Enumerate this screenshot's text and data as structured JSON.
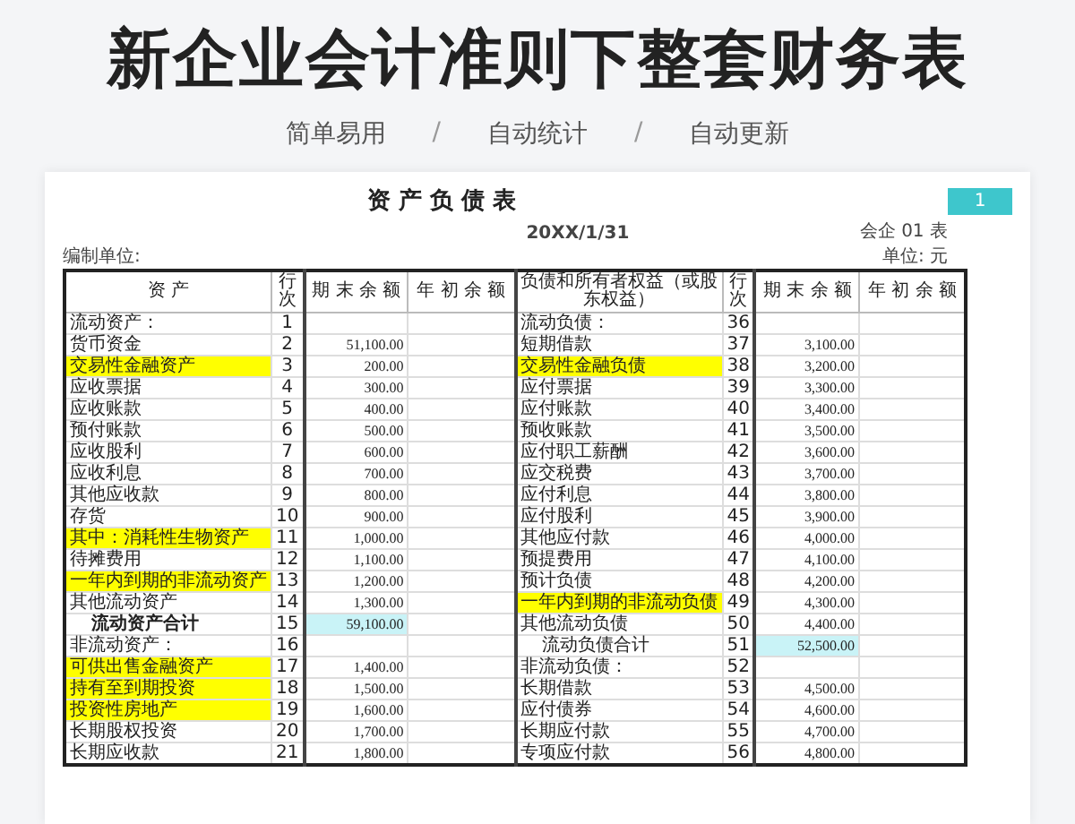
{
  "headline": "新企业会计准则下整套财务表",
  "taglines": [
    "简单易用",
    "自动统计",
    "自动更新"
  ],
  "tagline_separator": "/",
  "sheet": {
    "title": "资 产 负 债 表",
    "page_badge": "1",
    "form_code": "会企 01 表",
    "date": "20XX/1/31",
    "company_label": "编制单位:",
    "unit_label": "单位: 元",
    "columns": [
      "资 产",
      "行次",
      "期 末 余 额",
      "年 初 余 额",
      "负债和所有者权益（或股东权益）",
      "行次",
      "期 末 余 额",
      "年 初 余 额"
    ],
    "rows": [
      {
        "left": {
          "name": "流动资产：",
          "no": "1",
          "highlighted": false,
          "subtotal": false,
          "bold": false
        },
        "right": {
          "name": "流动负债：",
          "no": "36",
          "highlighted": false,
          "subtotal": false,
          "bold": false
        }
      },
      {
        "left": {
          "name": "货币资金",
          "no": "2",
          "end": "51,100.00",
          "highlighted": false,
          "subtotal": false,
          "bold": false
        },
        "right": {
          "name": "短期借款",
          "no": "37",
          "end": "3,100.00",
          "highlighted": false,
          "subtotal": false,
          "bold": false
        }
      },
      {
        "left": {
          "name": "交易性金融资产",
          "no": "3",
          "end": "200.00",
          "highlighted": true,
          "subtotal": false,
          "bold": false
        },
        "right": {
          "name": "交易性金融负债",
          "no": "38",
          "end": "3,200.00",
          "highlighted": true,
          "subtotal": false,
          "bold": false
        }
      },
      {
        "left": {
          "name": "应收票据",
          "no": "4",
          "end": "300.00",
          "highlighted": false,
          "subtotal": false,
          "bold": false
        },
        "right": {
          "name": "应付票据",
          "no": "39",
          "end": "3,300.00",
          "highlighted": false,
          "subtotal": false,
          "bold": false
        }
      },
      {
        "left": {
          "name": "应收账款",
          "no": "5",
          "end": "400.00",
          "highlighted": false,
          "subtotal": false,
          "bold": false
        },
        "right": {
          "name": "应付账款",
          "no": "40",
          "end": "3,400.00",
          "highlighted": false,
          "subtotal": false,
          "bold": false
        }
      },
      {
        "left": {
          "name": "预付账款",
          "no": "6",
          "end": "500.00",
          "highlighted": false,
          "subtotal": false,
          "bold": false
        },
        "right": {
          "name": "预收账款",
          "no": "41",
          "end": "3,500.00",
          "highlighted": false,
          "subtotal": false,
          "bold": false
        }
      },
      {
        "left": {
          "name": "应收股利",
          "no": "7",
          "end": "600.00",
          "highlighted": false,
          "subtotal": false,
          "bold": false
        },
        "right": {
          "name": "应付职工薪酬",
          "no": "42",
          "end": "3,600.00",
          "highlighted": false,
          "subtotal": false,
          "bold": false
        }
      },
      {
        "left": {
          "name": "应收利息",
          "no": "8",
          "end": "700.00",
          "highlighted": false,
          "subtotal": false,
          "bold": false
        },
        "right": {
          "name": "应交税费",
          "no": "43",
          "end": "3,700.00",
          "highlighted": false,
          "subtotal": false,
          "bold": false
        }
      },
      {
        "left": {
          "name": "其他应收款",
          "no": "9",
          "end": "800.00",
          "highlighted": false,
          "subtotal": false,
          "bold": false
        },
        "right": {
          "name": "应付利息",
          "no": "44",
          "end": "3,800.00",
          "highlighted": false,
          "subtotal": false,
          "bold": false
        }
      },
      {
        "left": {
          "name": "存货",
          "no": "10",
          "end": "900.00",
          "highlighted": false,
          "subtotal": false,
          "bold": false
        },
        "right": {
          "name": "应付股利",
          "no": "45",
          "end": "3,900.00",
          "highlighted": false,
          "subtotal": false,
          "bold": false
        }
      },
      {
        "left": {
          "name": "其中：消耗性生物资产",
          "no": "11",
          "end": "1,000.00",
          "highlighted": true,
          "subtotal": false,
          "bold": false
        },
        "right": {
          "name": "其他应付款",
          "no": "46",
          "end": "4,000.00",
          "highlighted": false,
          "subtotal": false,
          "bold": false
        }
      },
      {
        "left": {
          "name": "待摊费用",
          "no": "12",
          "end": "1,100.00",
          "highlighted": false,
          "subtotal": false,
          "bold": false
        },
        "right": {
          "name": "预提费用",
          "no": "47",
          "end": "4,100.00",
          "highlighted": false,
          "subtotal": false,
          "bold": false
        }
      },
      {
        "left": {
          "name": "一年内到期的非流动资产",
          "no": "13",
          "end": "1,200.00",
          "highlighted": true,
          "subtotal": false,
          "bold": false
        },
        "right": {
          "name": "预计负债",
          "no": "48",
          "end": "4,200.00",
          "highlighted": false,
          "subtotal": false,
          "bold": false
        }
      },
      {
        "left": {
          "name": "其他流动资产",
          "no": "14",
          "end": "1,300.00",
          "highlighted": false,
          "subtotal": false,
          "bold": false
        },
        "right": {
          "name": "一年内到期的非流动负债",
          "no": "49",
          "end": "4,300.00",
          "highlighted": true,
          "subtotal": false,
          "bold": false
        }
      },
      {
        "left": {
          "name": "流动资产合计",
          "no": "15",
          "end": "59,100.00",
          "highlighted": false,
          "subtotal": true,
          "bold": true
        },
        "right": {
          "name": "其他流动负债",
          "no": "50",
          "end": "4,400.00",
          "highlighted": false,
          "subtotal": false,
          "bold": false
        }
      },
      {
        "left": {
          "name": "非流动资产：",
          "no": "16",
          "highlighted": false,
          "subtotal": false,
          "bold": false
        },
        "right": {
          "name": "流动负债合计",
          "no": "51",
          "end": "52,500.00",
          "highlighted": false,
          "subtotal": true,
          "bold": false
        }
      },
      {
        "left": {
          "name": "可供出售金融资产",
          "no": "17",
          "end": "1,400.00",
          "highlighted": true,
          "subtotal": false,
          "bold": false
        },
        "right": {
          "name": "非流动负债：",
          "no": "52",
          "highlighted": false,
          "subtotal": false,
          "bold": false
        }
      },
      {
        "left": {
          "name": "持有至到期投资",
          "no": "18",
          "end": "1,500.00",
          "highlighted": true,
          "subtotal": false,
          "bold": false
        },
        "right": {
          "name": "长期借款",
          "no": "53",
          "end": "4,500.00",
          "highlighted": false,
          "subtotal": false,
          "bold": false
        }
      },
      {
        "left": {
          "name": "投资性房地产",
          "no": "19",
          "end": "1,600.00",
          "highlighted": true,
          "subtotal": false,
          "bold": false
        },
        "right": {
          "name": "应付债券",
          "no": "54",
          "end": "4,600.00",
          "highlighted": false,
          "subtotal": false,
          "bold": false
        }
      },
      {
        "left": {
          "name": "长期股权投资",
          "no": "20",
          "end": "1,700.00",
          "highlighted": false,
          "subtotal": false,
          "bold": false
        },
        "right": {
          "name": "长期应付款",
          "no": "55",
          "end": "4,700.00",
          "highlighted": false,
          "subtotal": false,
          "bold": false
        }
      },
      {
        "left": {
          "name": "长期应收款",
          "no": "21",
          "end": "1,800.00",
          "highlighted": false,
          "subtotal": false,
          "bold": false
        },
        "right": {
          "name": "专项应付款",
          "no": "56",
          "end": "4,800.00",
          "highlighted": false,
          "subtotal": false,
          "bold": false
        }
      }
    ]
  }
}
